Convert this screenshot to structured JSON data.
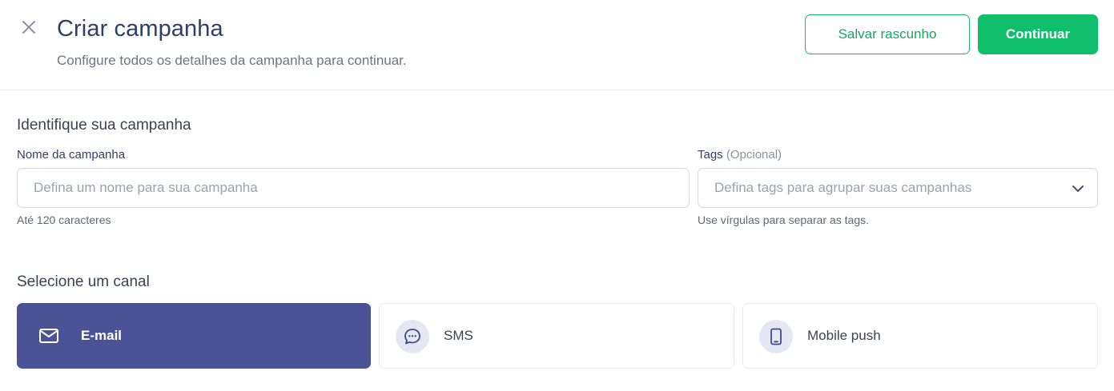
{
  "header": {
    "title": "Criar campanha",
    "subtitle": "Configure todos os detalhes da campanha para continuar.",
    "draft_label": "Salvar rascunho",
    "continue_label": "Continuar"
  },
  "identify": {
    "title": "Identifique sua campanha",
    "name_field": {
      "label": "Nome da campanha",
      "placeholder": "Defina um nome para sua campanha",
      "hint": "Até 120 caracteres"
    },
    "tags_field": {
      "label": "Tags",
      "optional": "(Opcional)",
      "placeholder": "Defina tags para agrupar suas campanhas",
      "hint": "Use vírgulas para separar as tags."
    }
  },
  "channels": {
    "title": "Selecione um canal",
    "selected": "E-mail",
    "items": [
      {
        "label": "E-mail",
        "icon": "mail-icon"
      },
      {
        "label": "SMS",
        "icon": "chat-bubble-icon"
      },
      {
        "label": "Mobile push",
        "icon": "smartphone-icon"
      }
    ]
  },
  "colors": {
    "accent_green": "#0fbf6c",
    "selected_channel": "#4a5396",
    "title_navy": "#2f3f6b"
  }
}
